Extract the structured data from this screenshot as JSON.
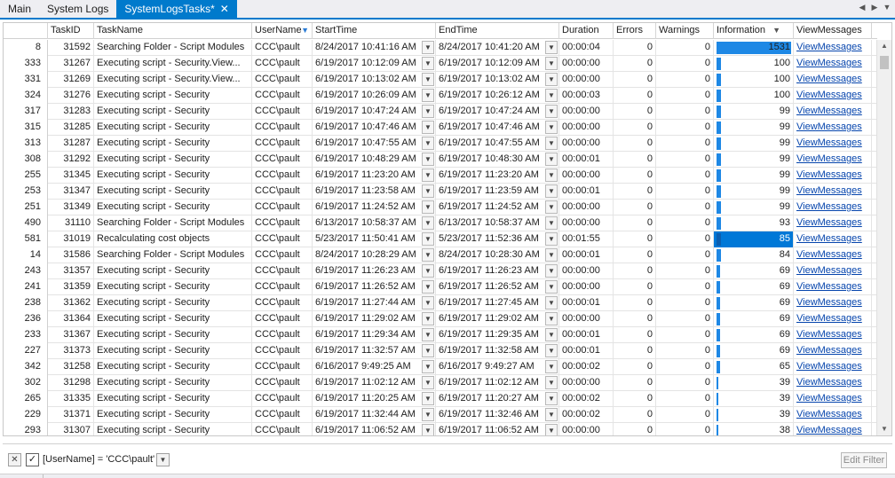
{
  "tabs": [
    {
      "label": "Main",
      "active": false
    },
    {
      "label": "System Logs",
      "active": false
    },
    {
      "label": "SystemLogsTasks*",
      "active": true
    }
  ],
  "tab_close_glyph": "✕",
  "columns": [
    "TaskID",
    "TaskName",
    "UserName",
    "StartTime",
    "EndTime",
    "Duration",
    "Errors",
    "Warnings",
    "Information",
    "ViewMessages"
  ],
  "rows": [
    {
      "rownum": "8",
      "taskid": "31592",
      "taskname": "Searching Folder - Script Modules",
      "user": "CCC\\pault",
      "start": "8/24/2017 10:41:16 AM",
      "end": "8/24/2017 10:41:20 AM",
      "duration": "00:00:04",
      "errors": "0",
      "warnings": "0",
      "info": 1531,
      "info_text": "1531",
      "view": "ViewMessages"
    },
    {
      "rownum": "333",
      "taskid": "31267",
      "taskname": "Executing script - Security.View...",
      "user": "CCC\\pault",
      "start": "6/19/2017 10:12:09 AM",
      "end": "6/19/2017 10:12:09 AM",
      "duration": "00:00:00",
      "errors": "0",
      "warnings": "0",
      "info": 100,
      "info_text": "100",
      "view": "ViewMessages"
    },
    {
      "rownum": "331",
      "taskid": "31269",
      "taskname": "Executing script - Security.View...",
      "user": "CCC\\pault",
      "start": "6/19/2017 10:13:02 AM",
      "end": "6/19/2017 10:13:02 AM",
      "duration": "00:00:00",
      "errors": "0",
      "warnings": "0",
      "info": 100,
      "info_text": "100",
      "view": "ViewMessages"
    },
    {
      "rownum": "324",
      "taskid": "31276",
      "taskname": "Executing script - Security",
      "user": "CCC\\pault",
      "start": "6/19/2017 10:26:09 AM",
      "end": "6/19/2017 10:26:12 AM",
      "duration": "00:00:03",
      "errors": "0",
      "warnings": "0",
      "info": 100,
      "info_text": "100",
      "view": "ViewMessages"
    },
    {
      "rownum": "317",
      "taskid": "31283",
      "taskname": "Executing script - Security",
      "user": "CCC\\pault",
      "start": "6/19/2017 10:47:24 AM",
      "end": "6/19/2017 10:47:24 AM",
      "duration": "00:00:00",
      "errors": "0",
      "warnings": "0",
      "info": 99,
      "info_text": "99",
      "view": "ViewMessages"
    },
    {
      "rownum": "315",
      "taskid": "31285",
      "taskname": "Executing script - Security",
      "user": "CCC\\pault",
      "start": "6/19/2017 10:47:46 AM",
      "end": "6/19/2017 10:47:46 AM",
      "duration": "00:00:00",
      "errors": "0",
      "warnings": "0",
      "info": 99,
      "info_text": "99",
      "view": "ViewMessages"
    },
    {
      "rownum": "313",
      "taskid": "31287",
      "taskname": "Executing script - Security",
      "user": "CCC\\pault",
      "start": "6/19/2017 10:47:55 AM",
      "end": "6/19/2017 10:47:55 AM",
      "duration": "00:00:00",
      "errors": "0",
      "warnings": "0",
      "info": 99,
      "info_text": "99",
      "view": "ViewMessages"
    },
    {
      "rownum": "308",
      "taskid": "31292",
      "taskname": "Executing script - Security",
      "user": "CCC\\pault",
      "start": "6/19/2017 10:48:29 AM",
      "end": "6/19/2017 10:48:30 AM",
      "duration": "00:00:01",
      "errors": "0",
      "warnings": "0",
      "info": 99,
      "info_text": "99",
      "view": "ViewMessages"
    },
    {
      "rownum": "255",
      "taskid": "31345",
      "taskname": "Executing script - Security",
      "user": "CCC\\pault",
      "start": "6/19/2017 11:23:20 AM",
      "end": "6/19/2017 11:23:20 AM",
      "duration": "00:00:00",
      "errors": "0",
      "warnings": "0",
      "info": 99,
      "info_text": "99",
      "view": "ViewMessages"
    },
    {
      "rownum": "253",
      "taskid": "31347",
      "taskname": "Executing script - Security",
      "user": "CCC\\pault",
      "start": "6/19/2017 11:23:58 AM",
      "end": "6/19/2017 11:23:59 AM",
      "duration": "00:00:01",
      "errors": "0",
      "warnings": "0",
      "info": 99,
      "info_text": "99",
      "view": "ViewMessages"
    },
    {
      "rownum": "251",
      "taskid": "31349",
      "taskname": "Executing script - Security",
      "user": "CCC\\pault",
      "start": "6/19/2017 11:24:52 AM",
      "end": "6/19/2017 11:24:52 AM",
      "duration": "00:00:00",
      "errors": "0",
      "warnings": "0",
      "info": 99,
      "info_text": "99",
      "view": "ViewMessages"
    },
    {
      "rownum": "490",
      "taskid": "31110",
      "taskname": "Searching Folder - Script Modules",
      "user": "CCC\\pault",
      "start": "6/13/2017 10:58:37 AM",
      "end": "6/13/2017 10:58:37 AM",
      "duration": "00:00:00",
      "errors": "0",
      "warnings": "0",
      "info": 93,
      "info_text": "93",
      "view": "ViewMessages"
    },
    {
      "rownum": "581",
      "taskid": "31019",
      "taskname": "Recalculating cost objects",
      "user": "CCC\\pault",
      "start": "5/23/2017 11:50:41 AM",
      "end": "5/23/2017 11:52:36 AM",
      "duration": "00:01:55",
      "errors": "0",
      "warnings": "0",
      "info": 85,
      "info_text": "85",
      "view": "ViewMessages",
      "selected": true
    },
    {
      "rownum": "14",
      "taskid": "31586",
      "taskname": "Searching Folder - Script Modules",
      "user": "CCC\\pault",
      "start": "8/24/2017 10:28:29 AM",
      "end": "8/24/2017 10:28:30 AM",
      "duration": "00:00:01",
      "errors": "0",
      "warnings": "0",
      "info": 84,
      "info_text": "84",
      "view": "ViewMessages"
    },
    {
      "rownum": "243",
      "taskid": "31357",
      "taskname": "Executing script - Security",
      "user": "CCC\\pault",
      "start": "6/19/2017 11:26:23 AM",
      "end": "6/19/2017 11:26:23 AM",
      "duration": "00:00:00",
      "errors": "0",
      "warnings": "0",
      "info": 69,
      "info_text": "69",
      "view": "ViewMessages"
    },
    {
      "rownum": "241",
      "taskid": "31359",
      "taskname": "Executing script - Security",
      "user": "CCC\\pault",
      "start": "6/19/2017 11:26:52 AM",
      "end": "6/19/2017 11:26:52 AM",
      "duration": "00:00:00",
      "errors": "0",
      "warnings": "0",
      "info": 69,
      "info_text": "69",
      "view": "ViewMessages"
    },
    {
      "rownum": "238",
      "taskid": "31362",
      "taskname": "Executing script - Security",
      "user": "CCC\\pault",
      "start": "6/19/2017 11:27:44 AM",
      "end": "6/19/2017 11:27:45 AM",
      "duration": "00:00:01",
      "errors": "0",
      "warnings": "0",
      "info": 69,
      "info_text": "69",
      "view": "ViewMessages"
    },
    {
      "rownum": "236",
      "taskid": "31364",
      "taskname": "Executing script - Security",
      "user": "CCC\\pault",
      "start": "6/19/2017 11:29:02 AM",
      "end": "6/19/2017 11:29:02 AM",
      "duration": "00:00:00",
      "errors": "0",
      "warnings": "0",
      "info": 69,
      "info_text": "69",
      "view": "ViewMessages"
    },
    {
      "rownum": "233",
      "taskid": "31367",
      "taskname": "Executing script - Security",
      "user": "CCC\\pault",
      "start": "6/19/2017 11:29:34 AM",
      "end": "6/19/2017 11:29:35 AM",
      "duration": "00:00:01",
      "errors": "0",
      "warnings": "0",
      "info": 69,
      "info_text": "69",
      "view": "ViewMessages"
    },
    {
      "rownum": "227",
      "taskid": "31373",
      "taskname": "Executing script - Security",
      "user": "CCC\\pault",
      "start": "6/19/2017 11:32:57 AM",
      "end": "6/19/2017 11:32:58 AM",
      "duration": "00:00:01",
      "errors": "0",
      "warnings": "0",
      "info": 69,
      "info_text": "69",
      "view": "ViewMessages"
    },
    {
      "rownum": "342",
      "taskid": "31258",
      "taskname": "Executing script - Security",
      "user": "CCC\\pault",
      "start": "6/16/2017 9:49:25 AM",
      "end": "6/16/2017 9:49:27 AM",
      "duration": "00:00:02",
      "errors": "0",
      "warnings": "0",
      "info": 65,
      "info_text": "65",
      "view": "ViewMessages"
    },
    {
      "rownum": "302",
      "taskid": "31298",
      "taskname": "Executing script - Security",
      "user": "CCC\\pault",
      "start": "6/19/2017 11:02:12 AM",
      "end": "6/19/2017 11:02:12 AM",
      "duration": "00:00:00",
      "errors": "0",
      "warnings": "0",
      "info": 39,
      "info_text": "39",
      "view": "ViewMessages"
    },
    {
      "rownum": "265",
      "taskid": "31335",
      "taskname": "Executing script - Security",
      "user": "CCC\\pault",
      "start": "6/19/2017 11:20:25 AM",
      "end": "6/19/2017 11:20:27 AM",
      "duration": "00:00:02",
      "errors": "0",
      "warnings": "0",
      "info": 39,
      "info_text": "39",
      "view": "ViewMessages"
    },
    {
      "rownum": "229",
      "taskid": "31371",
      "taskname": "Executing script - Security",
      "user": "CCC\\pault",
      "start": "6/19/2017 11:32:44 AM",
      "end": "6/19/2017 11:32:46 AM",
      "duration": "00:00:02",
      "errors": "0",
      "warnings": "0",
      "info": 39,
      "info_text": "39",
      "view": "ViewMessages"
    },
    {
      "rownum": "293",
      "taskid": "31307",
      "taskname": "Executing script - Security",
      "user": "CCC\\pault",
      "start": "6/19/2017 11:06:52 AM",
      "end": "6/19/2017 11:06:52 AM",
      "duration": "00:00:00",
      "errors": "0",
      "warnings": "0",
      "info": 38,
      "info_text": "38",
      "view": "ViewMessages"
    }
  ],
  "info_max": 1531,
  "filter": {
    "text": "[UserName] = 'CCC\\pault'",
    "enabled": true,
    "edit_label": "Edit Filter"
  },
  "colors": {
    "accent": "#007acc",
    "databar": "#1e88e5",
    "selected": "#0078d7",
    "link": "#0645ad"
  }
}
